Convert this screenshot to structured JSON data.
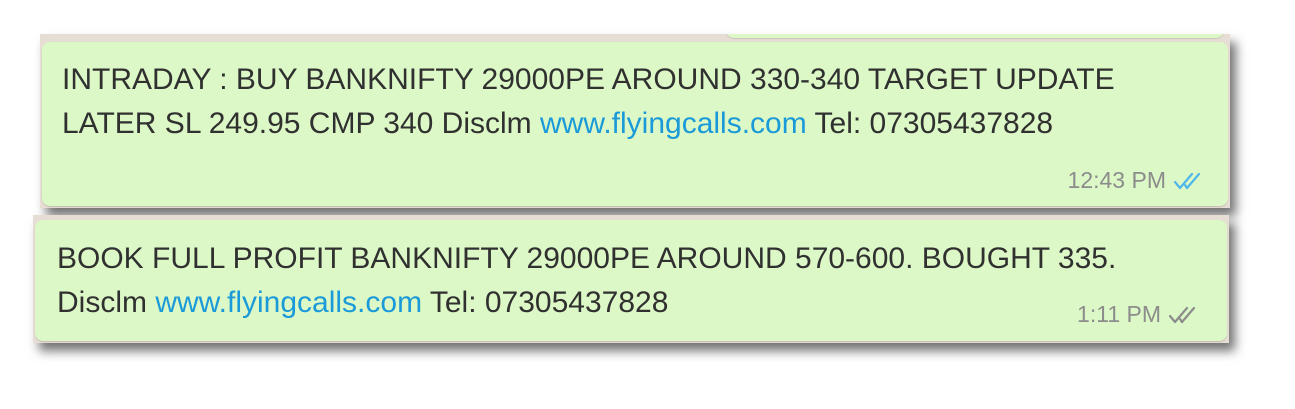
{
  "messages": [
    {
      "line1": "INTRADAY : BUY BANKNIFTY 29000PE AROUND 330-340 TARGET UPDATE",
      "line2_prefix": "LATER SL 249.95 CMP 340 Disclm ",
      "link": "www.flyingcalls.com",
      "line2_suffix": " Tel: 07305437828",
      "time": "12:43 PM",
      "status_icon": "double-check-read-icon",
      "tick_color": "#4fb6ec"
    },
    {
      "line1": "BOOK FULL PROFIT BANKNIFTY 29000PE AROUND 570-600. BOUGHT 335.",
      "line2_prefix": "Disclm ",
      "link": "www.flyingcalls.com",
      "line2_suffix": " Tel: 07305437828",
      "time": "1:11 PM",
      "status_icon": "double-check-delivered-icon",
      "tick_color": "#8c8c8c"
    }
  ],
  "colors": {
    "bubble": "#dcf8c6",
    "chat_background": "#e6ddd4",
    "text": "#303030",
    "link": "#1a9ad8",
    "meta": "#8c8c8c"
  }
}
